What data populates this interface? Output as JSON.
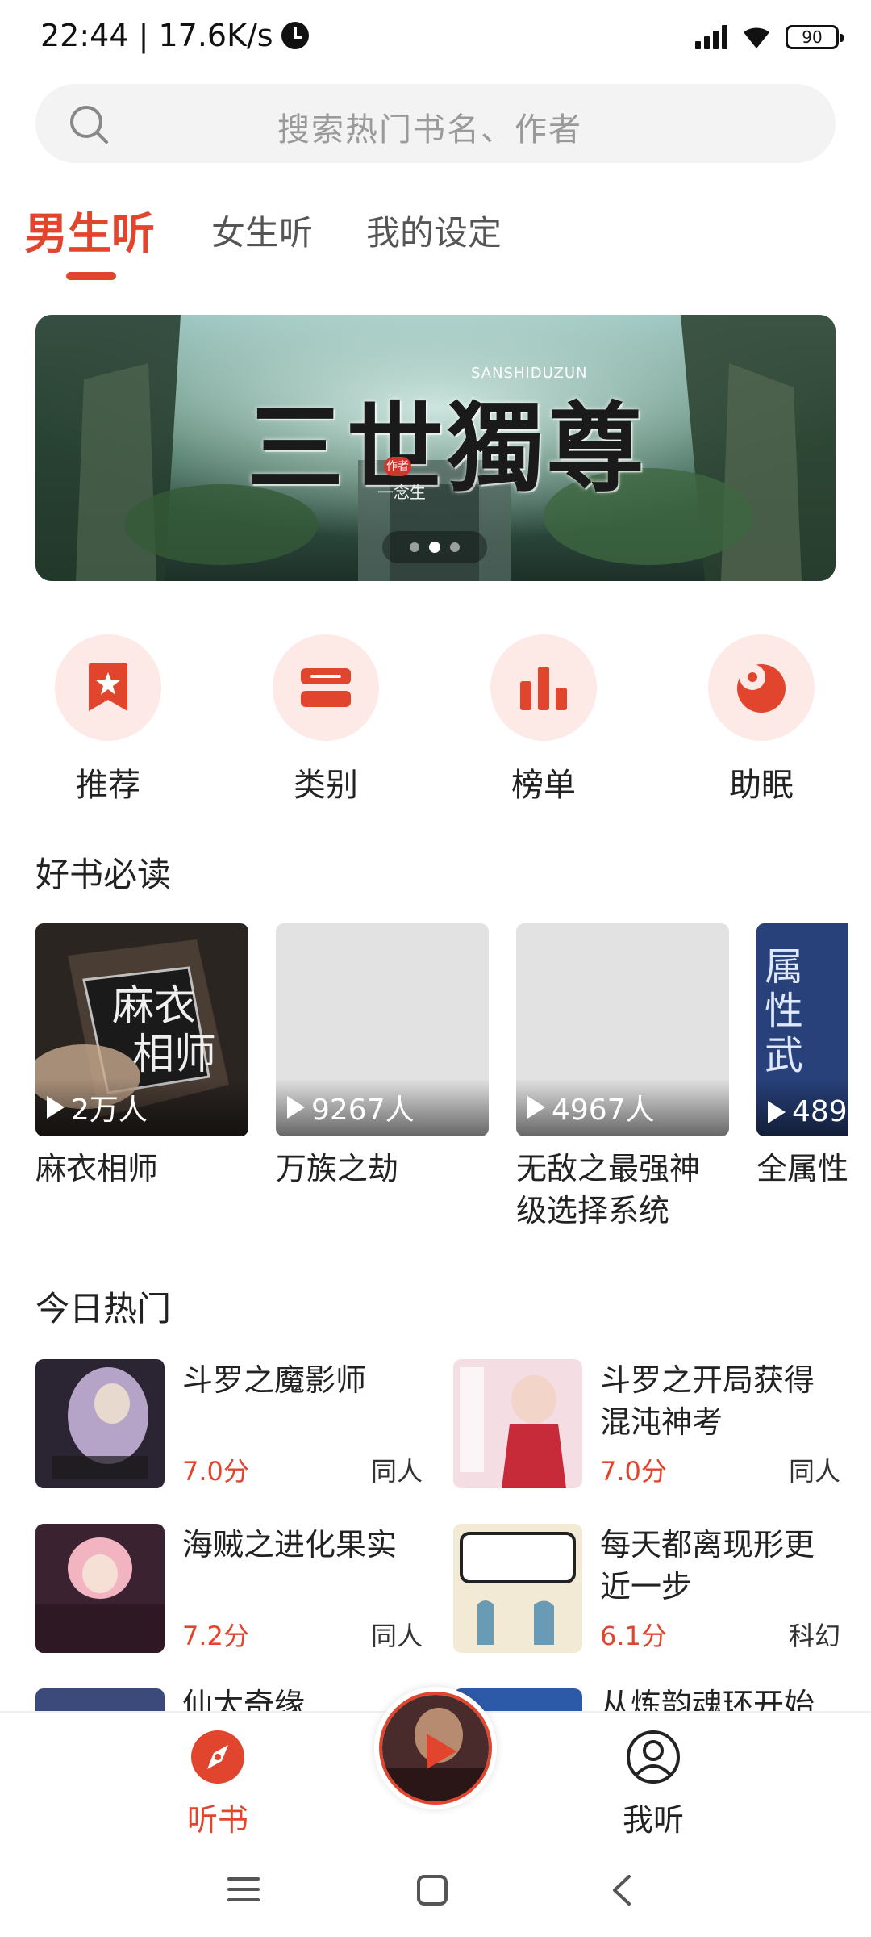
{
  "status_bar": {
    "time_speed": "22:44 | 17.6K/s",
    "battery": "90"
  },
  "search": {
    "placeholder": "搜索热门书名、作者"
  },
  "tabs": [
    {
      "label": "男生听",
      "active": true
    },
    {
      "label": "女生听",
      "active": false
    },
    {
      "label": "我的设定",
      "active": false
    }
  ],
  "banner": {
    "title": "三世獨尊",
    "subtitle": "SANSHIDUZUN",
    "seal": "作者",
    "author": "一念生"
  },
  "categories": [
    {
      "label": "推荐",
      "icon": "bookmark-star-icon"
    },
    {
      "label": "类别",
      "icon": "category-icon"
    },
    {
      "label": "榜单",
      "icon": "ranking-bars-icon"
    },
    {
      "label": "助眠",
      "icon": "sleep-moon-icon"
    }
  ],
  "good_books": {
    "title": "好书必读",
    "items": [
      {
        "title": "麻衣相师",
        "plays": "2万人"
      },
      {
        "title": "万族之劫",
        "plays": "9267人"
      },
      {
        "title": "无敌之最强神级选择系统",
        "plays": "4967人"
      },
      {
        "title": "全属性",
        "plays": "489"
      }
    ]
  },
  "hot_today": {
    "title": "今日热门",
    "items": [
      {
        "title": "斗罗之魔影师",
        "score": "7.0分",
        "genre": "同人"
      },
      {
        "title": "斗罗之开局获得混沌神考",
        "score": "7.0分",
        "genre": "同人"
      },
      {
        "title": "海贼之进化果实",
        "score": "7.2分",
        "genre": "同人"
      },
      {
        "title": "每天都离现形更近一步",
        "score": "6.1分",
        "genre": "科幻"
      },
      {
        "title": "仙太奇缘",
        "score": "",
        "genre": ""
      },
      {
        "title": "从炼韵魂环开始",
        "score": "",
        "genre": ""
      }
    ]
  },
  "bottom_nav": {
    "listen": "听书",
    "mine": "我听"
  },
  "colors": {
    "accent": "#e2452d",
    "accent_light": "#fde9e6"
  }
}
